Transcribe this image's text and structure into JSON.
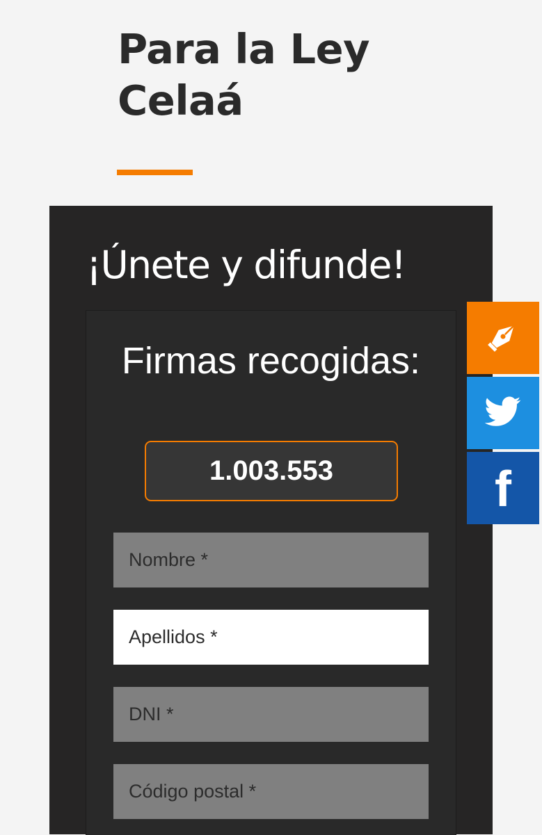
{
  "header": {
    "title": "Para la Ley Celaá"
  },
  "panel": {
    "heading": "¡Únete y difunde!",
    "counter_label": "Firmas recogidas:",
    "counter_value": "1.003.553"
  },
  "form": {
    "fields": [
      {
        "placeholder": "Nombre *",
        "value": ""
      },
      {
        "placeholder": "Apellidos *",
        "value": ""
      },
      {
        "placeholder": "DNI *",
        "value": ""
      },
      {
        "placeholder": "Código postal *",
        "value": ""
      }
    ]
  },
  "share_bar": {
    "buttons": [
      {
        "icon": "pen-nib-icon",
        "color": "#f57c00"
      },
      {
        "icon": "twitter-icon",
        "color": "#1d8fe0"
      },
      {
        "icon": "facebook-icon",
        "label": "f",
        "color": "#1456a8"
      }
    ]
  },
  "colors": {
    "accent": "#f57c00",
    "panel_background": "#262525",
    "page_background": "#f4f4f4"
  }
}
